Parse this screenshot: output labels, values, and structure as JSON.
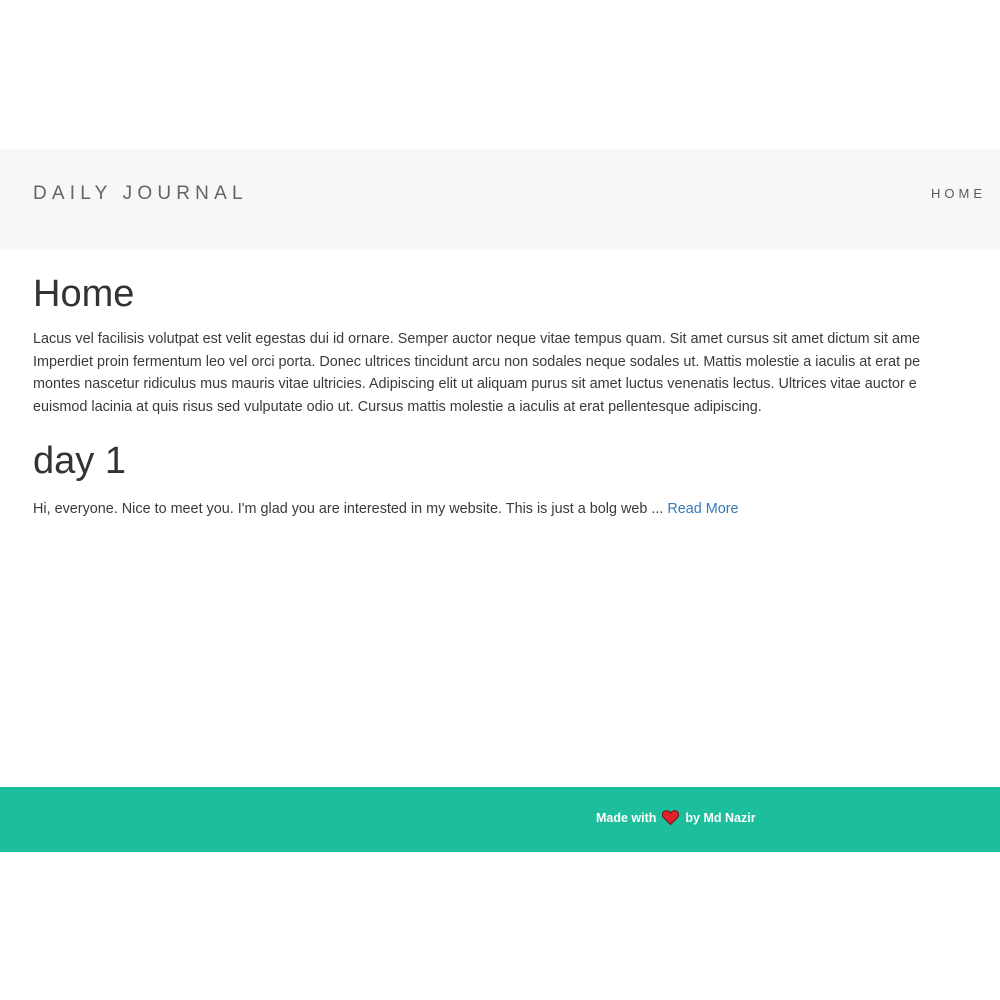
{
  "header": {
    "brand": "DAILY JOURNAL",
    "nav": {
      "home_label": "HOME"
    }
  },
  "main": {
    "title": "Home",
    "intro_lines": [
      "Lacus vel facilisis volutpat est velit egestas dui id ornare. Semper auctor neque vitae tempus quam. Sit amet cursus sit amet dictum sit ame",
      "Imperdiet proin fermentum leo vel orci porta. Donec ultrices tincidunt arcu non sodales neque sodales ut. Mattis molestie a iaculis at erat pe",
      "montes nascetur ridiculus mus mauris vitae ultricies. Adipiscing elit ut aliquam purus sit amet luctus venenatis lectus. Ultrices vitae auctor e",
      "euismod lacinia at quis risus sed vulputate odio ut. Cursus mattis molestie a iaculis at erat pellentesque adipiscing."
    ],
    "posts": [
      {
        "title": "day 1",
        "excerpt": "Hi, everyone. Nice to meet you. I'm glad you are interested in my website. This is just a bolg web ... ",
        "read_more": "Read More"
      }
    ]
  },
  "footer": {
    "made_with": "Made with",
    "heart_icon": "heart-icon",
    "by_author": "by Md Nazir"
  },
  "colors": {
    "navbar_bg": "#f7f7f7",
    "footer_bg": "#1dbe9c",
    "link": "#337ab7",
    "heart": "#e0202a"
  }
}
